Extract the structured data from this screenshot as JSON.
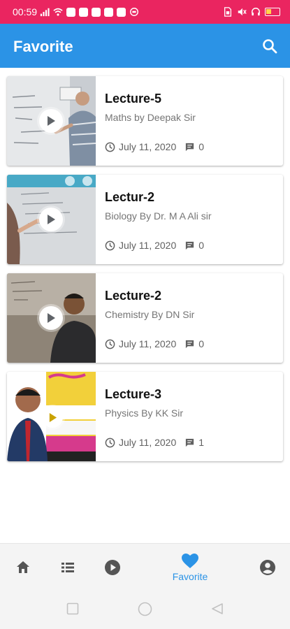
{
  "status_bar": {
    "time": "00:59",
    "background": "#ea2560",
    "left_icons": [
      "signal-icon",
      "wifi-icon",
      "app-notification-icon",
      "app-notification-icon",
      "app-notification-icon",
      "app-notification-icon",
      "app-notification-icon",
      "vpn-icon"
    ],
    "right_icons": [
      "sim-icon",
      "mute-icon",
      "headset-icon",
      "battery-icon"
    ]
  },
  "app_bar": {
    "title": "Favorite",
    "background": "#2b93e6",
    "search_icon": "search-icon"
  },
  "favorites": [
    {
      "title": "Lecture-5",
      "subtitle": "Maths by Deepak Sir",
      "date": "July 11, 2020",
      "comments": "0",
      "thumbnail": "whiteboard-lecture-image"
    },
    {
      "title": "Lectur-2",
      "subtitle": "Biology By Dr. M A Ali sir",
      "date": "July 11, 2020",
      "comments": "0",
      "thumbnail": "whiteboard-lecture-image"
    },
    {
      "title": "Lecture-2",
      "subtitle": "Chemistry By DN Sir",
      "date": "July 11, 2020",
      "comments": "0",
      "thumbnail": "classroom-lecture-image"
    },
    {
      "title": "Lecture-3",
      "subtitle": "Physics By KK Sir",
      "date": "July 11, 2020",
      "comments": "1",
      "thumbnail": "poster-lecture-image"
    }
  ],
  "bottom_nav": {
    "items": [
      {
        "icon": "home-icon",
        "label": "",
        "active": false
      },
      {
        "icon": "list-icon",
        "label": "",
        "active": false
      },
      {
        "icon": "play-circle-icon",
        "label": "",
        "active": false
      },
      {
        "icon": "heart-icon",
        "label": "Favorite",
        "active": true
      },
      {
        "icon": "account-icon",
        "label": "",
        "active": false
      }
    ],
    "active_color": "#2b93e6",
    "inactive_color": "#555555"
  },
  "system_nav": [
    "recents-icon",
    "home-circle-icon",
    "back-triangle-icon"
  ]
}
